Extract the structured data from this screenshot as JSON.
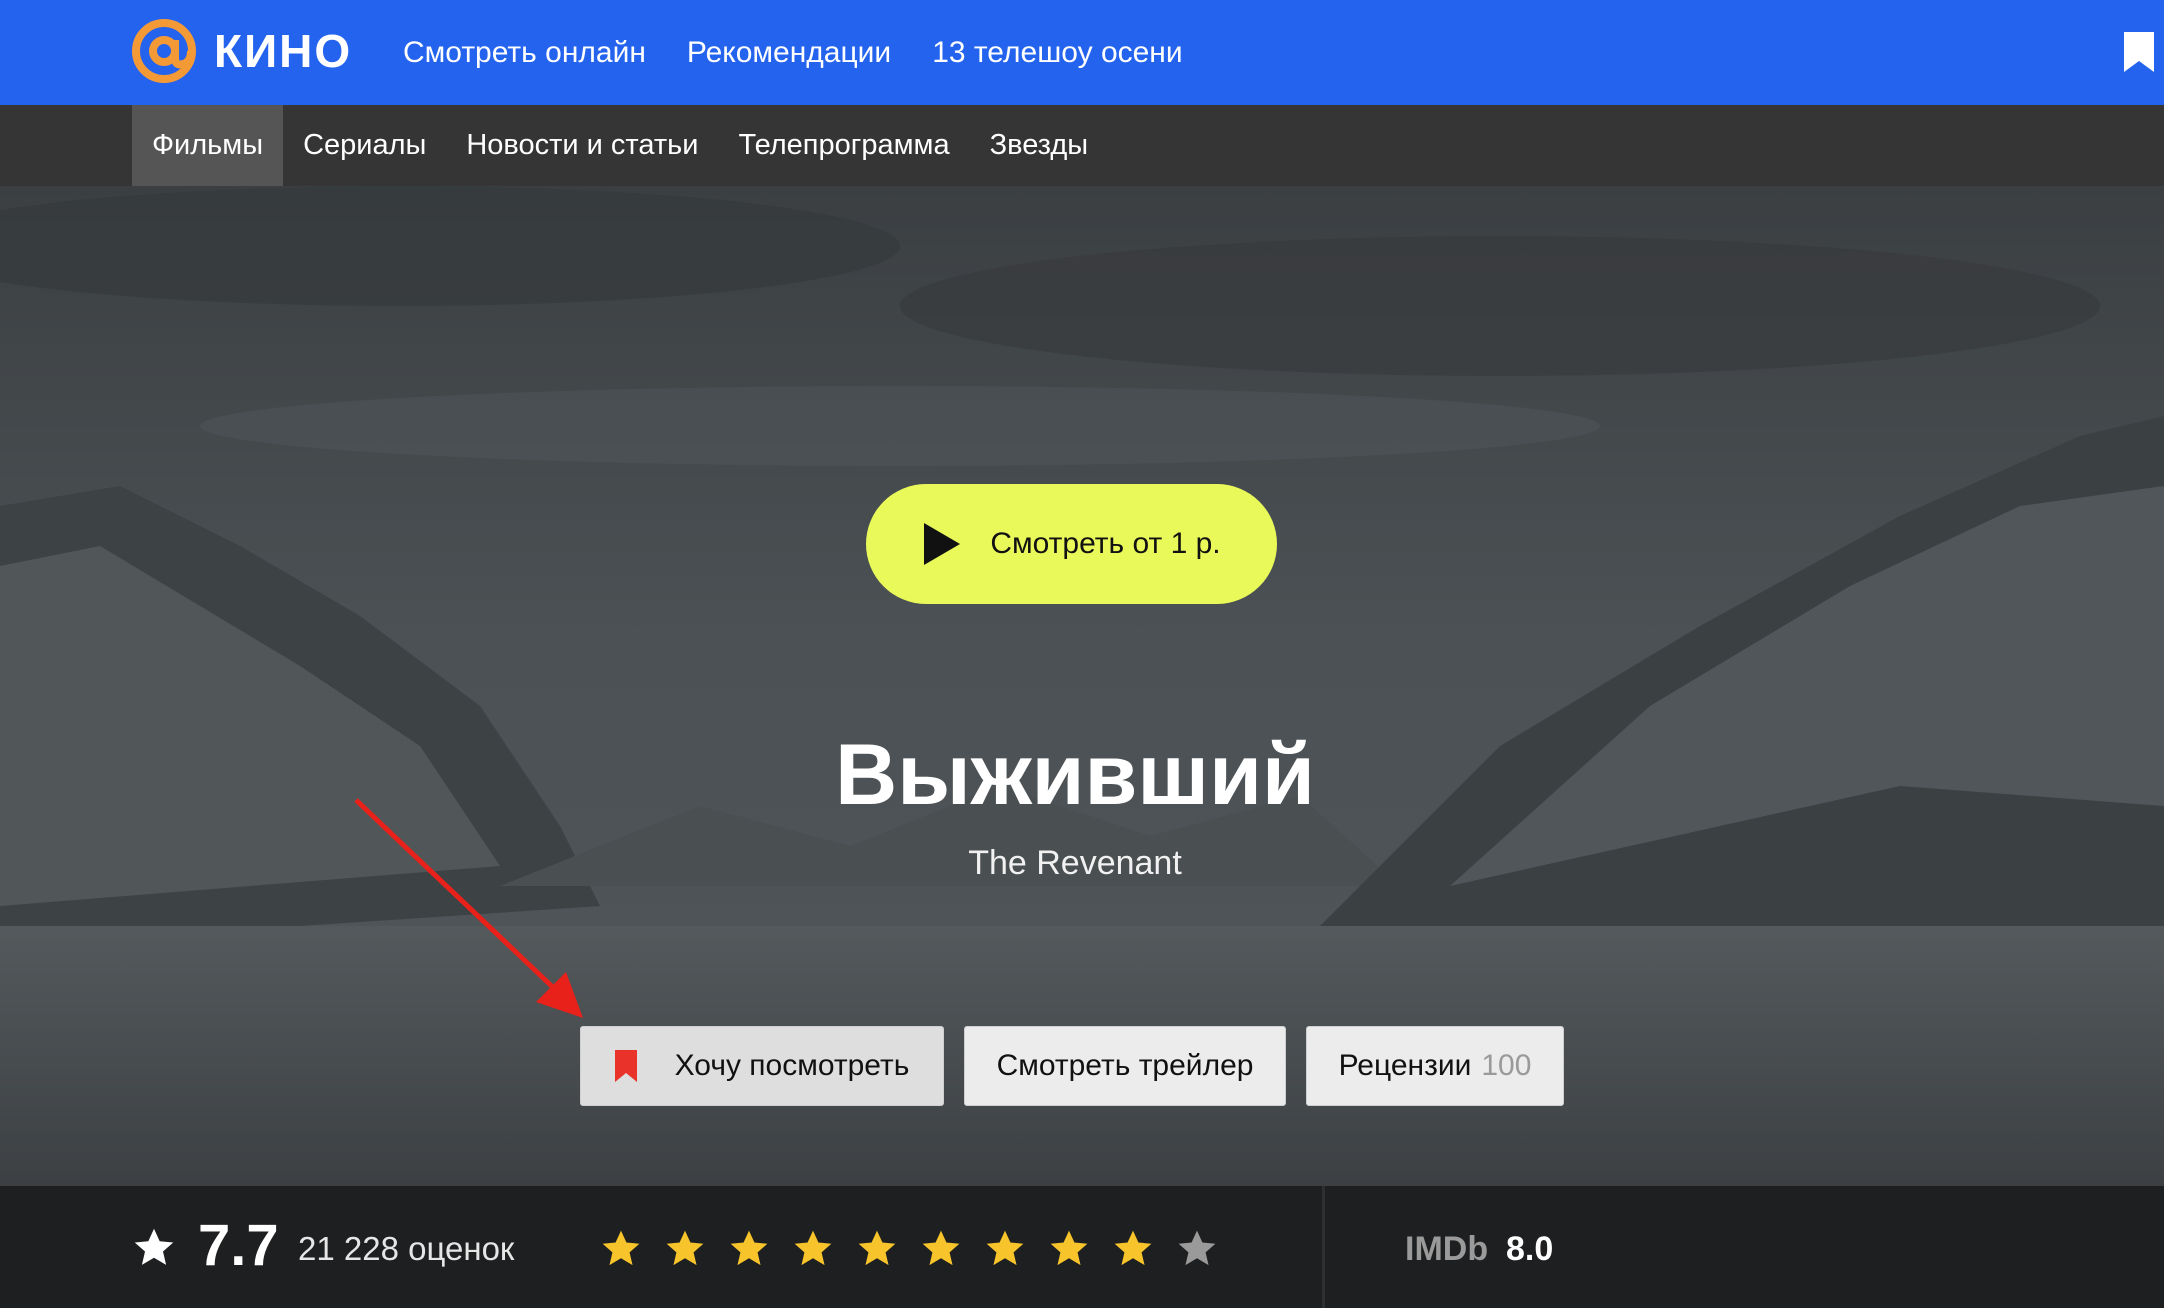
{
  "header": {
    "logo_text": "КИНО",
    "brand_color": "#2463ee",
    "logo_accent": "#f39a37",
    "nav": [
      "Смотреть онлайн",
      "Рекомендации",
      "13 телешоу осени"
    ],
    "bookmark_icon": "bookmark-icon"
  },
  "subnav": {
    "items": [
      "Фильмы",
      "Сериалы",
      "Новости и статьи",
      "Телепрограмма",
      "Звезды"
    ],
    "active": "Фильмы"
  },
  "hero": {
    "watch_button": "Смотреть от 1 р.",
    "watch_button_color": "#eaf95a",
    "title": "Выживший",
    "original_title": "The Revenant",
    "actions": {
      "want": "Хочу посмотреть",
      "trailer": "Смотреть трейлер",
      "reviews": "Рецензии",
      "reviews_count": "100"
    }
  },
  "rating": {
    "value": "7.7",
    "votes": "21 228 оценок",
    "stars_filled": 9,
    "stars_total": 10,
    "star_color": "#f7c52b",
    "imdb_label": "IMDb",
    "imdb_value": "8.0"
  }
}
